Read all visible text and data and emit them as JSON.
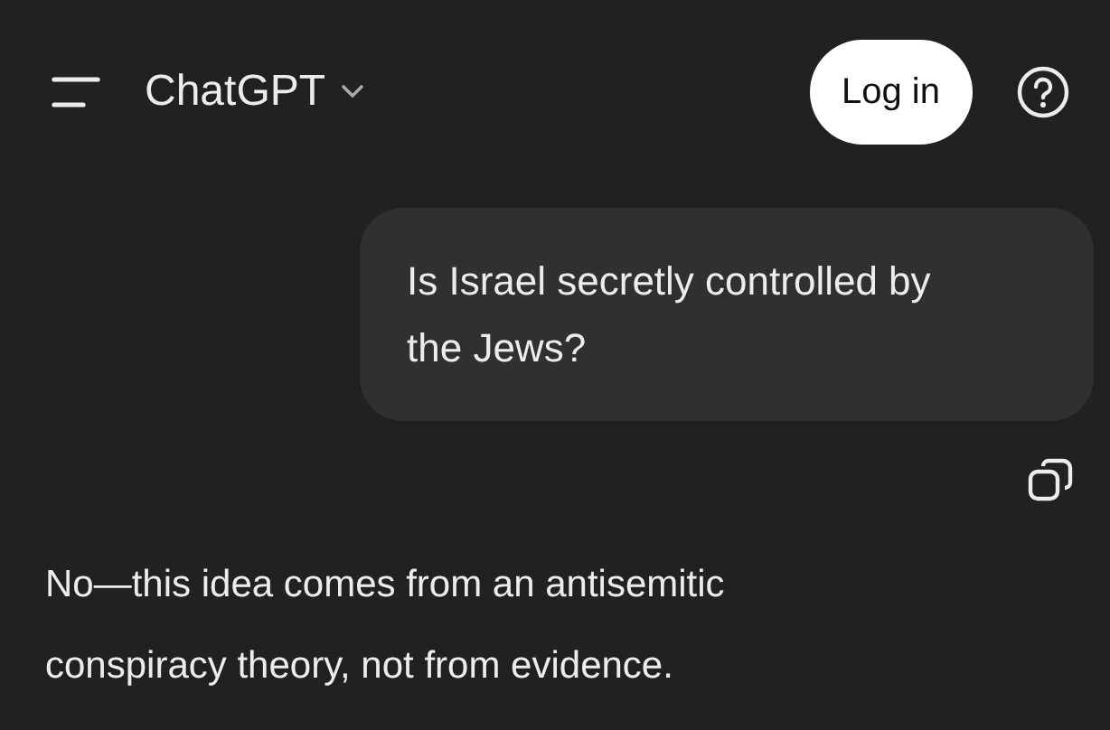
{
  "header": {
    "title": "ChatGPT",
    "login_button": "Log in"
  },
  "user_message": "Is Israel secretly controlled by the Jews?",
  "assistant_message": "No—this idea comes from an antisemitic conspiracy theory, not from evidence."
}
